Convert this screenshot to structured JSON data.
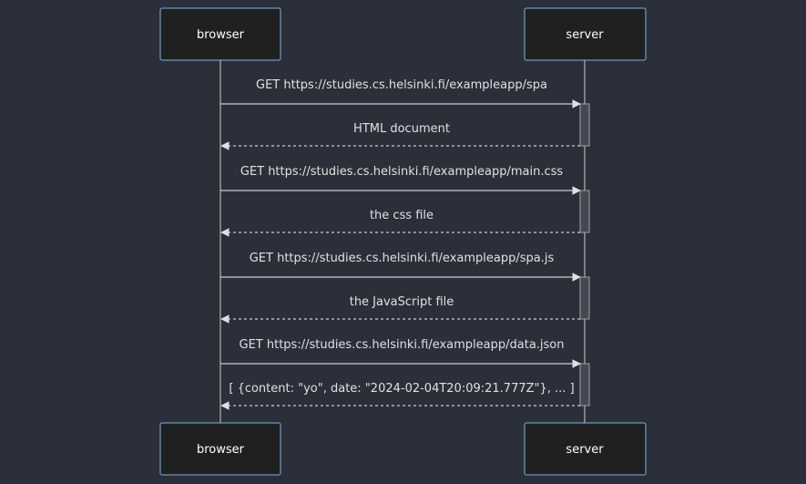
{
  "actors": [
    {
      "id": "browser",
      "label": "browser"
    },
    {
      "id": "server",
      "label": "server"
    }
  ],
  "messages": [
    {
      "from": "browser",
      "to": "server",
      "text": "GET https://studies.cs.helsinki.fi/exampleapp/spa",
      "style": "solid"
    },
    {
      "from": "server",
      "to": "browser",
      "text": "HTML document",
      "style": "dashed"
    },
    {
      "from": "browser",
      "to": "server",
      "text": "GET https://studies.cs.helsinki.fi/exampleapp/main.css",
      "style": "solid"
    },
    {
      "from": "server",
      "to": "browser",
      "text": "the css file",
      "style": "dashed"
    },
    {
      "from": "browser",
      "to": "server",
      "text": "GET https://studies.cs.helsinki.fi/exampleapp/spa.js",
      "style": "solid"
    },
    {
      "from": "server",
      "to": "browser",
      "text": "the JavaScript file",
      "style": "dashed"
    },
    {
      "from": "browser",
      "to": "server",
      "text": "GET https://studies.cs.helsinki.fi/exampleapp/data.json",
      "style": "solid"
    },
    {
      "from": "server",
      "to": "browser",
      "text": "[ {content: \"yo\", date: \"2024-02-04T20:09:21.777Z\"}, ... ]",
      "style": "dashed"
    }
  ],
  "colors": {
    "background": "#2b2f3a",
    "actor_fill": "#1f2020",
    "actor_border": "#81b1db",
    "line": "#cccccc",
    "text": "#e0e0e0"
  }
}
